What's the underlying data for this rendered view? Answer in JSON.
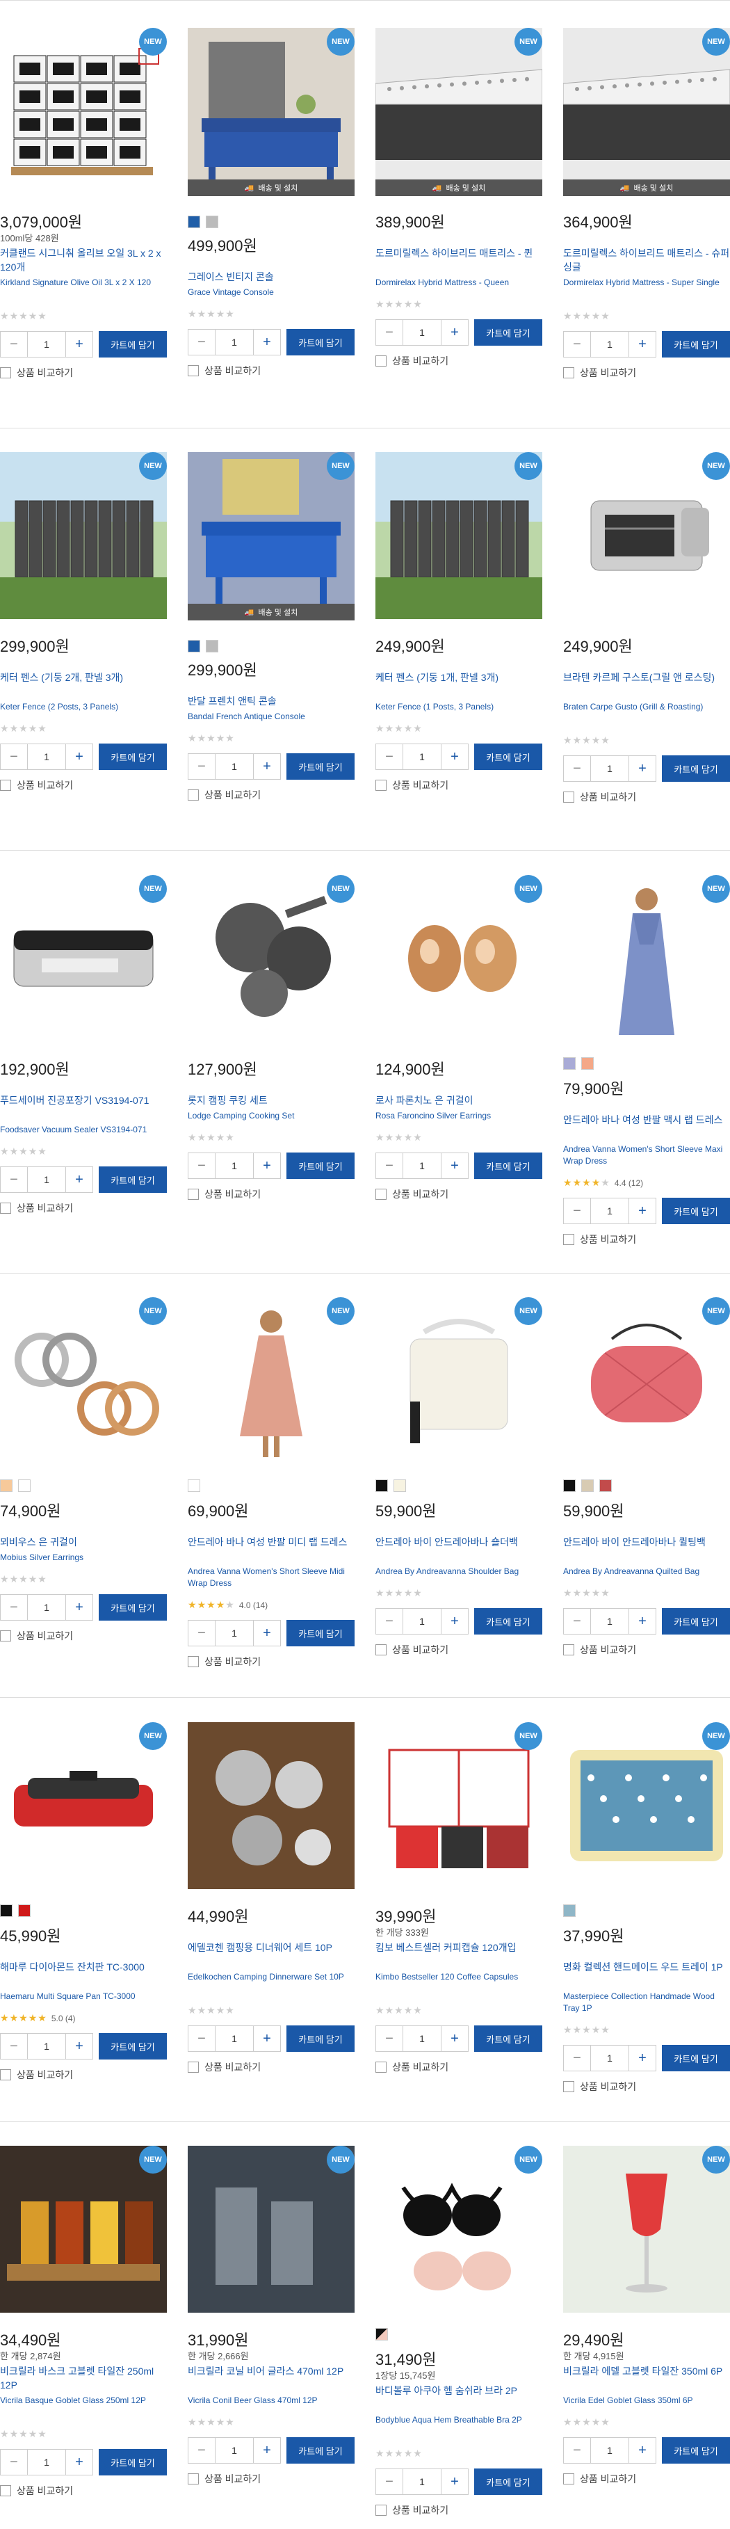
{
  "ui": {
    "new_badge": "NEW",
    "install_label": "배송 및 설치",
    "cart_label": "카트에 담기",
    "compare_label": "상품 비교하기",
    "qty_value": "1",
    "minus": "−",
    "plus": "+"
  },
  "rows": [
    [
      {
        "price": "3,079,000원",
        "unit": "100ml당 428원",
        "name_ko": "커클랜드 시그니춰 올리브 오일 3L x 2 x 120개",
        "name_en": "Kirkland Signature Olive Oil 3L x 2 X 120",
        "new": true,
        "install": false,
        "swatches": [],
        "image": "olive-oil-pallet"
      },
      {
        "price": "499,900원",
        "unit": "",
        "name_ko": "그레이스 빈티지 콘솔",
        "name_en": "Grace Vintage Console",
        "new": true,
        "install": true,
        "swatches": [
          "#1f5ea8",
          "#bbbbbb"
        ],
        "image": "blue-console"
      },
      {
        "price": "389,900원",
        "unit": "",
        "name_ko": "도르미릴렉스 하이브리드 매트리스 - 퀸",
        "name_en": "Dormirelax Hybrid Mattress - Queen",
        "new": true,
        "install": true,
        "swatches": [],
        "image": "mattress"
      },
      {
        "price": "364,900원",
        "unit": "",
        "name_ko": "도르미릴렉스 하이브리드 매트리스 - 슈퍼싱글",
        "name_en": "Dormirelax Hybrid Mattress - Super Single",
        "new": true,
        "install": true,
        "swatches": [],
        "image": "mattress"
      }
    ],
    [
      {
        "price": "299,900원",
        "unit": "",
        "name_ko": "케터 펜스 (기둥 2개, 판넬 3개)",
        "name_en": "Keter Fence (2 Posts, 3 Panels)",
        "new": true,
        "install": false,
        "swatches": [],
        "image": "fence"
      },
      {
        "price": "299,900원",
        "unit": "",
        "name_ko": "반달 프렌치 앤틱 콘솔",
        "name_en": "Bandal French Antique Console",
        "new": true,
        "install": true,
        "swatches": [
          "#1f5ea8",
          "#bbbbbb"
        ],
        "image": "antique-console"
      },
      {
        "price": "249,900원",
        "unit": "",
        "name_ko": "케터 펜스 (기둥 1개, 판넬 3개)",
        "name_en": "Keter Fence (1 Posts, 3 Panels)",
        "new": true,
        "install": false,
        "swatches": [],
        "image": "fence"
      },
      {
        "price": "249,900원",
        "unit": "",
        "name_ko": "브라텐 카르페 구스토(그릴 앤 로스팅)",
        "name_en": "Braten Carpe Gusto (Grill & Roasting)",
        "new": true,
        "install": false,
        "swatches": [],
        "image": "grill"
      }
    ],
    [
      {
        "price": "192,900원",
        "unit": "",
        "name_ko": "푸드세이버 진공포장기 VS3194-071",
        "name_en": "Foodsaver Vacuum Sealer VS3194-071",
        "new": true,
        "install": false,
        "swatches": [],
        "image": "vacuum-sealer"
      },
      {
        "price": "127,900원",
        "unit": "",
        "name_ko": "롯지 캠핑 쿠킹 세트",
        "name_en": "Lodge Camping Cooking Set",
        "new": true,
        "install": false,
        "swatches": [],
        "image": "cast-iron"
      },
      {
        "price": "124,900원",
        "unit": "",
        "name_ko": "로사 파론치노 은 귀걸이",
        "name_en": "Rosa Faroncino Silver Earrings",
        "new": true,
        "install": false,
        "swatches": [],
        "image": "gold-earrings"
      },
      {
        "price": "79,900원",
        "unit": "",
        "name_ko": "안드레아 바나 여성 반팔 맥시 랩 드레스",
        "name_en": "Andrea Vanna Women's Short Sleeve Maxi Wrap Dress",
        "new": true,
        "install": false,
        "swatches": [
          "#a9abd6",
          "#f4a888"
        ],
        "image": "maxi-dress",
        "rating": 4.4,
        "reviews": "(12)"
      }
    ],
    [
      {
        "price": "74,900원",
        "unit": "",
        "name_ko": "뫼비우스 은 귀걸이",
        "name_en": "Mobius Silver Earrings",
        "new": true,
        "install": false,
        "swatches": [
          "#f7c99a",
          "#ffffff"
        ],
        "image": "hoop-earrings"
      },
      {
        "price": "69,900원",
        "unit": "",
        "name_ko": "안드레아 바나 여성 반팔 미디 랩 드레스",
        "name_en": "Andrea Vanna Women's Short Sleeve Midi Wrap Dress",
        "new": true,
        "install": false,
        "swatches": [
          "#ffffff"
        ],
        "image": "midi-dress",
        "rating": 4.0,
        "reviews": "(14)"
      },
      {
        "price": "59,900원",
        "unit": "",
        "name_ko": "안드레아 바이 안드레아바나 숄더백",
        "name_en": "Andrea By Andreavanna Shoulder Bag",
        "new": true,
        "install": false,
        "swatches": [
          "#111111",
          "#f7f3e1"
        ],
        "image": "shoulder-bag"
      },
      {
        "price": "59,900원",
        "unit": "",
        "name_ko": "안드레아 바이 안드레아바나 퀼팅백",
        "name_en": "Andrea By Andreavanna Quilted Bag",
        "new": true,
        "install": false,
        "swatches": [
          "#111111",
          "#d8cbb3",
          "#c24b4b"
        ],
        "image": "quilted-bag"
      }
    ],
    [
      {
        "price": "45,990원",
        "unit": "",
        "name_ko": "해마루 다이아몬드 잔치판 TC-3000",
        "name_en": "Haemaru Multi Square Pan TC-3000",
        "new": true,
        "install": false,
        "swatches": [
          "#111111",
          "#d01a1a"
        ],
        "image": "grill-pan",
        "rating": 5.0,
        "reviews": "(4)"
      },
      {
        "price": "44,990원",
        "unit": "",
        "name_ko": "에델코첸 캠핑용 디너웨어 세트 10P",
        "name_en": "Edelkochen Camping Dinnerware Set 10P",
        "new": false,
        "install": false,
        "swatches": [],
        "image": "dinnerware"
      },
      {
        "price": "39,990원",
        "unit": "한 개당 333원",
        "name_ko": "킴보 베스트셀러 커피캡슐 120개입",
        "name_en": "Kimbo Bestseller 120 Coffee Capsules",
        "new": true,
        "install": false,
        "swatches": [],
        "image": "coffee"
      },
      {
        "price": "37,990원",
        "unit": "",
        "name_ko": "명화 컬렉션 핸드메이드 우드 트레이 1P",
        "name_en": "Masterpiece Collection Handmade Wood Tray 1P",
        "new": true,
        "install": false,
        "swatches": [
          "#8fb6c7"
        ],
        "image": "tray"
      }
    ],
    [
      {
        "price": "34,490원",
        "unit": "한 개당 2,874원",
        "name_ko": "비크릴라 바스크 고블렛 타일잔 250ml 12P",
        "name_en": "Vicrila Basque Goblet Glass 250ml 12P",
        "new": true,
        "install": false,
        "swatches": [],
        "image": "beer-flight"
      },
      {
        "price": "31,990원",
        "unit": "한 개당 2,666원",
        "name_ko": "비크릴라 코닐 비어 글라스 470ml 12P",
        "name_en": "Vicrila Conil Beer Glass 470ml 12P",
        "new": true,
        "install": false,
        "swatches": [],
        "image": "glasses"
      },
      {
        "price": "31,490원",
        "unit": "1장당 15,745원",
        "name_ko": "바디볼루 아쿠아 헴 숨쉬라 브라 2P",
        "name_en": "Bodyblue Aqua Hem Breathable Bra 2P",
        "new": true,
        "install": false,
        "swatches": [
          "pattern"
        ],
        "image": "bras"
      },
      {
        "price": "29,490원",
        "unit": "한 개당 4,915원",
        "name_ko": "비크릴라 에델 고블렛 타일잔 350ml 6P",
        "name_en": "Vicrila Edel Goblet Glass 350ml 6P",
        "new": true,
        "install": false,
        "swatches": [],
        "image": "goblet"
      }
    ]
  ]
}
